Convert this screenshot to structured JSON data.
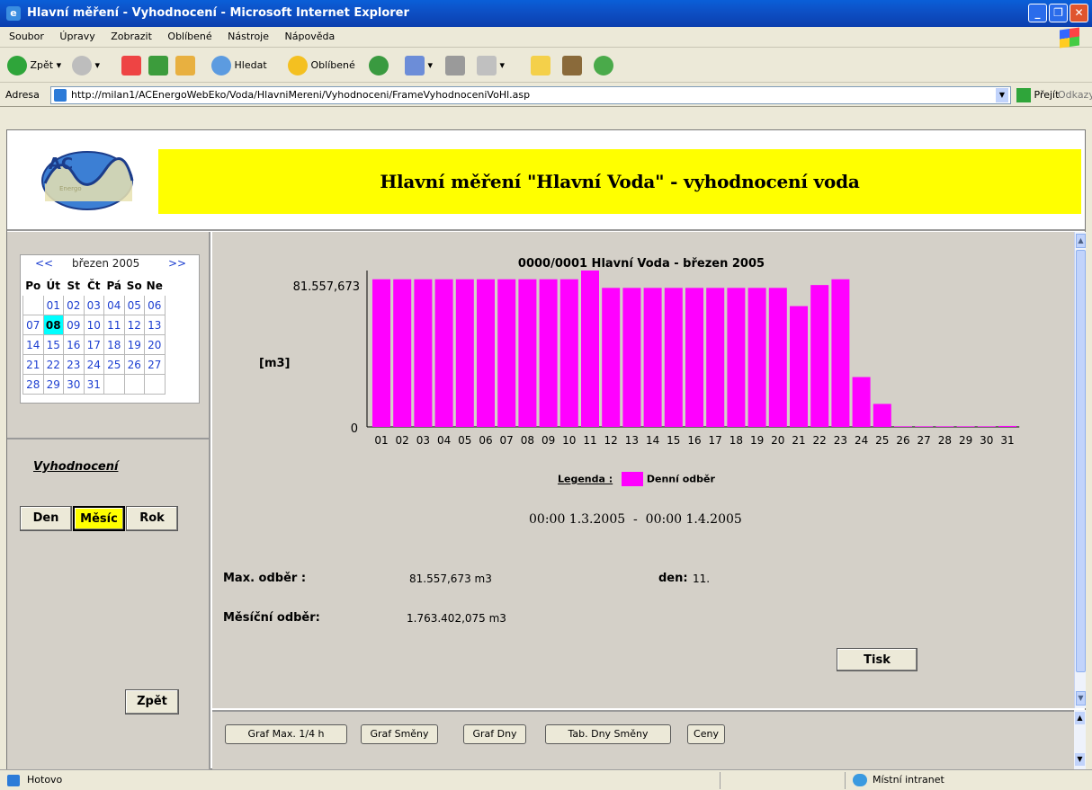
{
  "window": {
    "title": "Hlavní měření - Vyhodnocení - Microsoft Internet Explorer"
  },
  "menu": [
    "Soubor",
    "Úpravy",
    "Zobrazit",
    "Oblíbené",
    "Nástroje",
    "Nápověda"
  ],
  "toolbar": {
    "back": "Zpět",
    "search": "Hledat",
    "favorites": "Oblíbené"
  },
  "address": {
    "label": "Adresa",
    "url": "http://milan1/ACEnergoWebEko/Voda/HlavniMereni/Vyhodnoceni/FrameVyhodnoceniVoHl.asp",
    "go": "Přejít",
    "links": "Odkazy"
  },
  "logo": {
    "text": "AC",
    "subtext": "Energo"
  },
  "page": {
    "title": "Hlavní měření \"Hlavní Voda\" - vyhodnocení voda"
  },
  "calendar": {
    "prev": "<<",
    "next": ">>",
    "month": "březen 2005",
    "days": [
      "Po",
      "Út",
      "St",
      "Čt",
      "Pá",
      "So",
      "Ne"
    ],
    "weeks": [
      [
        "",
        "01",
        "02",
        "03",
        "04",
        "05",
        "06"
      ],
      [
        "07",
        "08",
        "09",
        "10",
        "11",
        "12",
        "13"
      ],
      [
        "14",
        "15",
        "16",
        "17",
        "18",
        "19",
        "20"
      ],
      [
        "21",
        "22",
        "23",
        "24",
        "25",
        "26",
        "27"
      ],
      [
        "28",
        "29",
        "30",
        "31",
        "",
        "",
        ""
      ]
    ],
    "today": "08"
  },
  "sidebar": {
    "heading": "Vyhodnocení",
    "btn_day": "Den",
    "btn_month": "Měsíc",
    "btn_year": "Rok",
    "btn_back": "Zpět"
  },
  "chart_data": {
    "type": "bar",
    "title": "0000/0001 Hlavní Voda - březen 2005",
    "ylabel": "[m3]",
    "ytick_max": "81.557,673",
    "ytick_min": "0",
    "ylim": [
      0,
      81.557673
    ],
    "legend_title": "Legenda :",
    "series": [
      {
        "name": "Denní odběr",
        "color": "#FF00FF"
      }
    ],
    "categories": [
      "01",
      "02",
      "03",
      "04",
      "05",
      "06",
      "07",
      "08",
      "09",
      "10",
      "11",
      "12",
      "13",
      "14",
      "15",
      "16",
      "17",
      "18",
      "19",
      "20",
      "21",
      "22",
      "23",
      "24",
      "25",
      "26",
      "27",
      "28",
      "29",
      "30",
      "31"
    ],
    "values": [
      77.0,
      77.0,
      77.0,
      77.0,
      77.0,
      77.0,
      77.0,
      77.0,
      77.0,
      77.0,
      81.557673,
      72.5,
      72.5,
      72.5,
      72.5,
      72.5,
      72.5,
      72.5,
      72.5,
      72.5,
      63.0,
      74.0,
      77.0,
      26.0,
      12.0,
      0.3,
      0.3,
      0.3,
      0.3,
      0.3,
      0.5
    ]
  },
  "summary": {
    "period": "00:00 1.3.2005  -  00:00 1.4.2005",
    "max_label": "Max. odběr :",
    "max_value": "81.557,673 m3",
    "day_label": "den:",
    "day_value": "11.",
    "month_label": "Měsíční odběr:",
    "month_value": "1.763.402,075 m3",
    "print": "Tisk"
  },
  "bottom_buttons": [
    "Graf Max. 1/4 h",
    "Graf Směny",
    "Graf Dny",
    "Tab. Dny Směny",
    "Ceny"
  ],
  "status": {
    "left": "Hotovo",
    "zone": "Místní intranet"
  }
}
